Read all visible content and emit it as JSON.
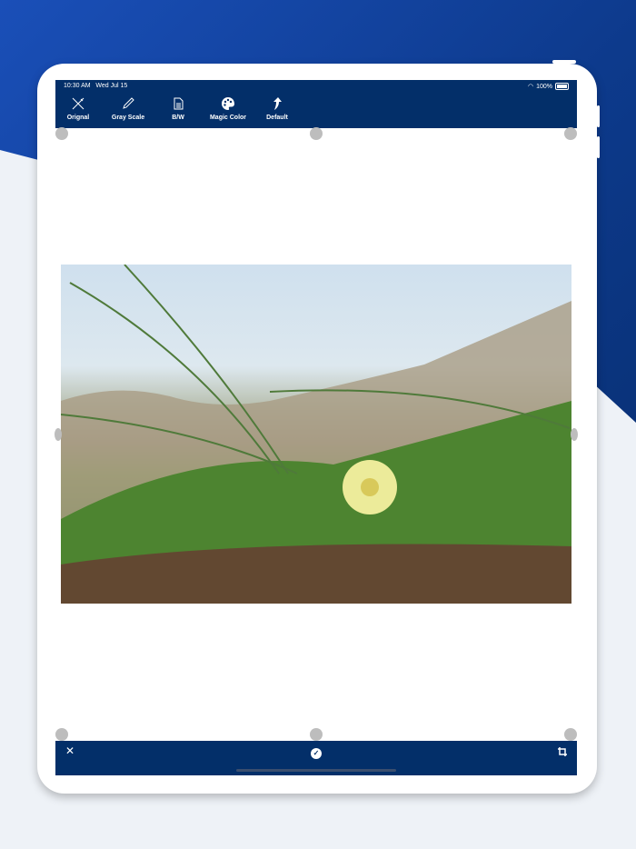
{
  "status_bar": {
    "time": "10:30 AM",
    "date": "Wed Jul 15",
    "battery": "100%"
  },
  "toolbar": {
    "items": [
      {
        "label": "Orignal",
        "icon": "wand-off-icon"
      },
      {
        "label": "Gray Scale",
        "icon": "pencil-icon"
      },
      {
        "label": "B/W",
        "icon": "document-icon"
      },
      {
        "label": "Magic Color",
        "icon": "palette-icon"
      },
      {
        "label": "Default",
        "icon": "arrow-up-icon"
      }
    ]
  },
  "colors": {
    "bar": "#032f69",
    "handle": "#bdbdbd"
  }
}
